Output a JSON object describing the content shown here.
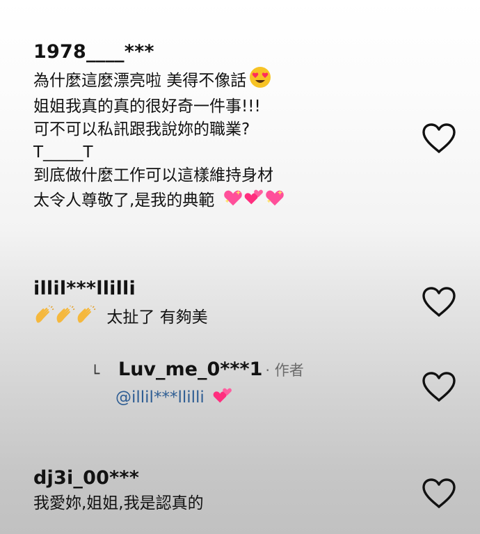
{
  "comments": [
    {
      "username": "1978____***",
      "lines": [
        "為什麼這麼漂亮啦 美得不像話",
        "姐姐我真的真的很好奇一件事!!!",
        "可不可以私訊跟我說妳的職業?",
        "T_____T",
        "到底做什麼工作可以這樣維持身材",
        "太令人尊敬了,是我的典範"
      ],
      "icons": [
        "heart-eyes-emoji",
        "sparkling-heart-emoji",
        "two-hearts-emoji",
        "sparkling-heart-emoji"
      ]
    },
    {
      "username": "illil***llilli",
      "text": "太扯了 有夠美",
      "icons": [
        "clapping-hands-emoji",
        "clapping-hands-emoji",
        "clapping-hands-emoji"
      ]
    },
    {
      "reply_username": "Luv_me_0***1",
      "reply_tag": "· 作者",
      "mention": "@illil***llilli",
      "icons": [
        "two-hearts-emoji"
      ]
    },
    {
      "username": "dj3i_00***",
      "text": "我愛妳,姐姐,我是認真的"
    }
  ],
  "like_icon": "heart-outline-icon",
  "accent_colors": {
    "mention": "#2e5d93",
    "heart_emoji": "#ff2e7e"
  }
}
